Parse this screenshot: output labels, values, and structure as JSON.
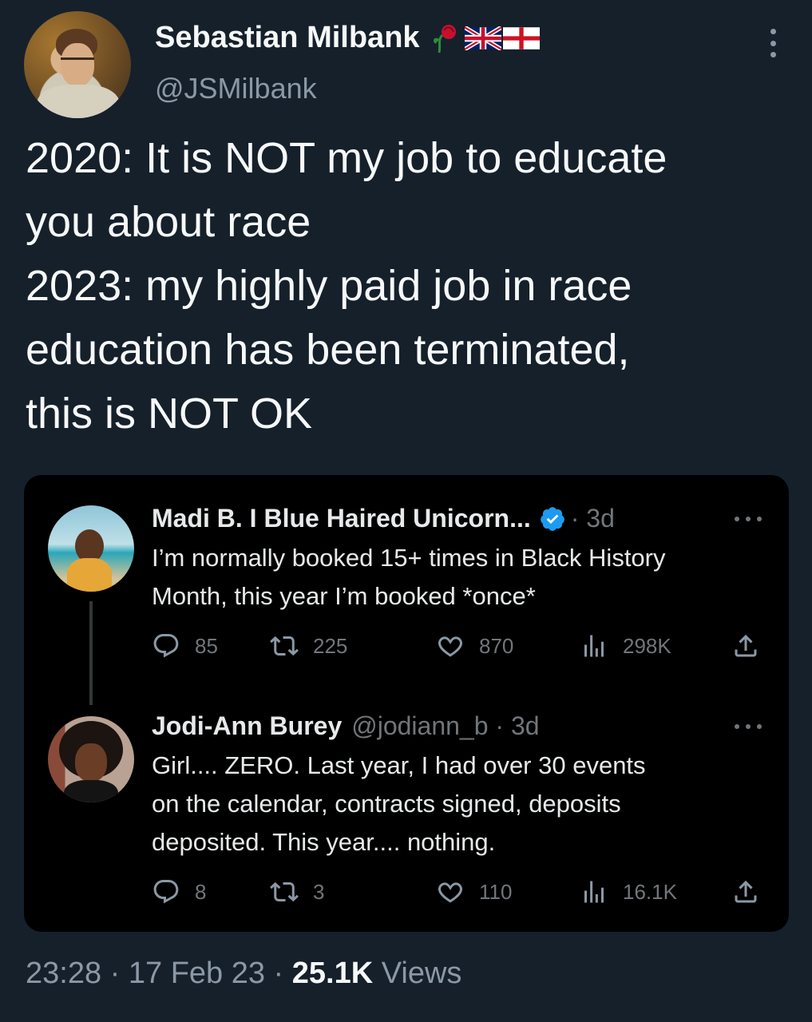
{
  "author": {
    "name": "Sebastian Milbank",
    "handle": "@JSMilbank",
    "flag_icons": [
      "rose-icon",
      "uk-flag-icon",
      "england-flag-icon"
    ]
  },
  "tweet": {
    "text": "2020: It is NOT my job to educate\nyou about race\n2023: my highly paid job in race\neducation has been terminated,\nthis is NOT OK"
  },
  "quoted": {
    "first": {
      "name": "Madi B. I Blue Haired Unicorn...",
      "verified": true,
      "time": "· 3d",
      "text": "I’m normally booked 15+ times in Black History\nMonth, this year I’m booked *once*",
      "replies": "85",
      "retweets": "225",
      "likes": "870",
      "views": "298K"
    },
    "second": {
      "name": "Jodi-Ann Burey",
      "handle_time": "@jodiann_b · 3d",
      "text": "Girl.... ZERO. Last year, I had over 30 events\non the calendar, contracts signed, deposits\ndeposited. This year.... nothing.",
      "replies": "8",
      "retweets": "3",
      "likes": "110",
      "views": "16.1K"
    }
  },
  "footer": {
    "time_date": "23:28 · 17 Feb 23 · ",
    "views_count": "25.1K",
    "views_label": " Views"
  },
  "colors": {
    "background": "#15202b",
    "card": "#000000",
    "muted": "#8b98a5",
    "verified": "#1d9bf0"
  }
}
